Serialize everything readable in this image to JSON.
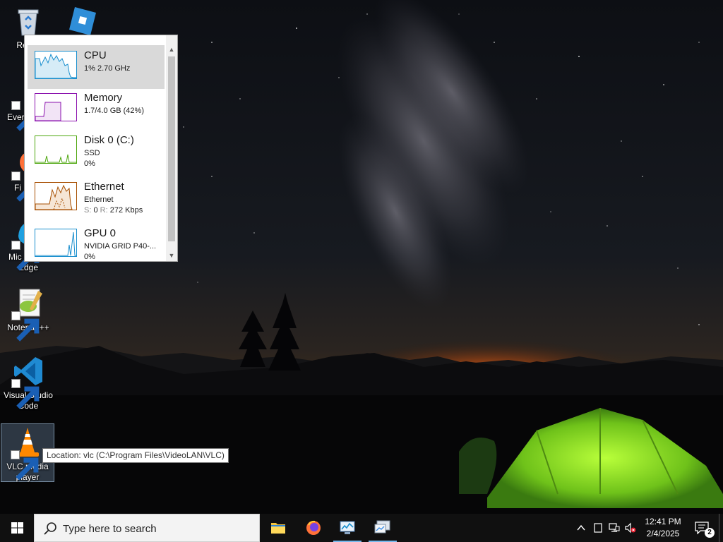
{
  "desktop": {
    "icons": [
      {
        "name": "recycle-bin",
        "label": "Recyc"
      },
      {
        "name": "roblox",
        "label": ""
      },
      {
        "name": "everything",
        "label": "Ever"
      },
      {
        "name": "firefox",
        "label": "Fi"
      },
      {
        "name": "edge",
        "label_line1": "Mic",
        "label_line2": "Edge"
      },
      {
        "name": "notepadpp",
        "label": "Notepad++"
      },
      {
        "name": "vscode",
        "label_line1": "Visual Studio",
        "label_line2": "Code"
      },
      {
        "name": "vlc",
        "label_line1": "VLC media",
        "label_line2": "player"
      }
    ],
    "tooltip": "Location: vlc (C:\\Program Files\\VideoLAN\\VLC)"
  },
  "task_manager": {
    "items": [
      {
        "title": "CPU",
        "line1": "1% 2.70 GHz",
        "color": "#1a8fce",
        "active": true
      },
      {
        "title": "Memory",
        "line1": "1.7/4.0 GB (42%)",
        "color": "#8b12ae"
      },
      {
        "title": "Disk 0 (C:)",
        "line1": "SSD",
        "line2": "0%",
        "color": "#4da60c"
      },
      {
        "title": "Ethernet",
        "line1": "Ethernet",
        "line2_s": "S:",
        "line2_sv": "0",
        "line2_r": "R:",
        "line2_rv": "272 Kbps",
        "color": "#a74f01"
      },
      {
        "title": "GPU 0",
        "line1": "NVIDIA GRID P40-...",
        "line2": "0%",
        "color": "#1a8fce"
      }
    ]
  },
  "taskbar": {
    "search_placeholder": "Type here to search",
    "apps": [
      "file-explorer",
      "firefox",
      "task-manager",
      "remote-desktop"
    ],
    "clock_time": "12:41 PM",
    "clock_date": "2/4/2025",
    "notification_count": "2"
  }
}
